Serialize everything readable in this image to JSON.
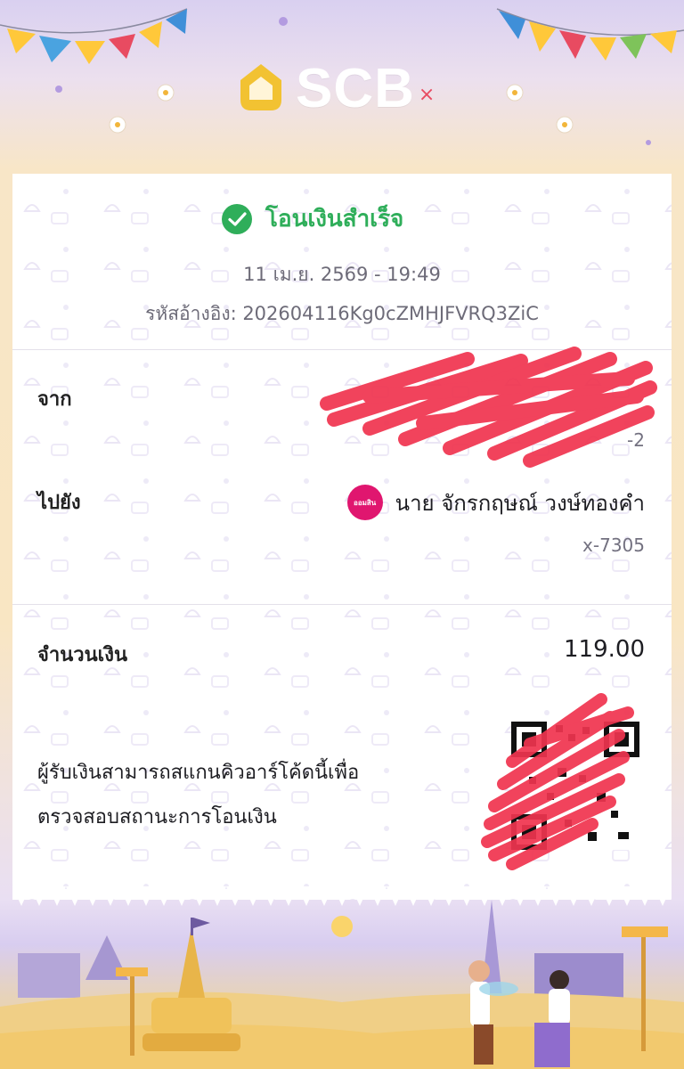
{
  "brand": {
    "name": "SCB",
    "accent": "#6d3fb0",
    "logo_gold": "#f2c232"
  },
  "status": {
    "text": "โอนเงินสำเร็จ",
    "color": "#2fae5a",
    "icon": "check-circle-icon"
  },
  "transaction": {
    "datetime": "11 เม.ย. 2569 - 19:49",
    "reference": "รหัสอ้างอิง: 202604116Kg0cZMHJFVRQ3ZiC"
  },
  "from": {
    "label": "จาก",
    "name": "",
    "account": "-2"
  },
  "to": {
    "label": "ไปยัง",
    "name": "นาย จักรกฤษณ์ วงษ์ทองคำ",
    "account": "x-7305",
    "bank_logo_text": "ออมสิน",
    "bank_color": "#e0166f"
  },
  "amount": {
    "label": "จำนวนเงิน",
    "value": "119.00"
  },
  "qr_note": {
    "line1": "ผู้รับเงินสามารถสแกนคิวอาร์โค้ดนี้เพื่อ",
    "line2": "ตรวจสอบสถานะการโอนเงิน"
  }
}
